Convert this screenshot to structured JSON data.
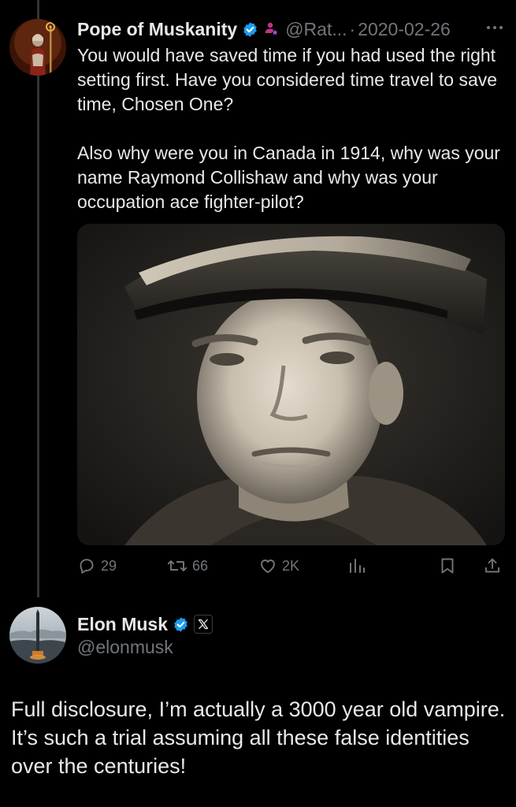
{
  "reply": {
    "display_name": "Pope of Muskanity",
    "handle": "@Rat...",
    "separator": "·",
    "timestamp": "2020-02-26",
    "paragraphs": [
      "You would have saved time if you had used the right setting first. Have you considered time travel to save time, Chosen One?",
      "Also why were you in Canada in 1914, why was your name Raymond Collishaw and why was your occupation ace fighter-pilot?"
    ],
    "media_icon": "sepia-portrait-photo",
    "actions": {
      "replies": "29",
      "reposts": "66",
      "likes": "2K"
    }
  },
  "main": {
    "display_name": "Elon Musk",
    "handle": "@elonmusk",
    "text": "Full disclosure, I’m actually a 3000 year old vampire. It’s such a trial assuming all these false identities over the centuries!"
  },
  "colors": {
    "background": "#000000",
    "text_primary": "#e7e9ea",
    "text_secondary": "#71767b",
    "verified": "#1d9bf0",
    "affiliate": "#c13584",
    "thread_line": "#333639"
  }
}
